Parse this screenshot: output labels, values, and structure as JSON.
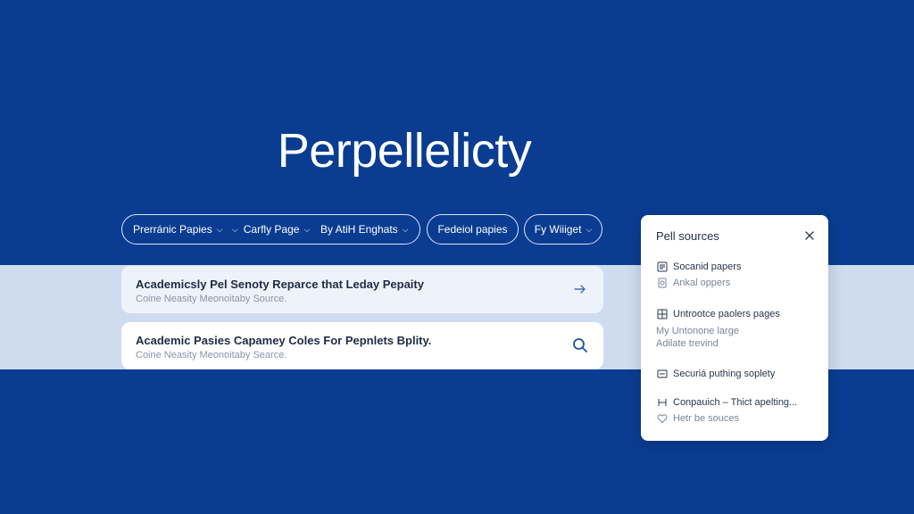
{
  "app": {
    "title": "Perpellelicty"
  },
  "filters": {
    "group": [
      "Prerránic Papies",
      "Carfly Page",
      "By AtiH Enghats"
    ],
    "federal": "Fedeiol papies",
    "widget": "Fy Wiiiget"
  },
  "results": [
    {
      "title": "Academicsly Pel Senoty Reparce that Leday Pepaity",
      "subtitle": "Coine Neasity Meonoitaby Source.",
      "icon": "arrow-right-icon"
    },
    {
      "title": "Academic Pasies Capamey Coles For Pepnlets Bplity.",
      "subtitle": "Coine Neasity Meonoitaby Searce.",
      "icon": "search-icon"
    }
  ],
  "panel": {
    "title": "Pell sources",
    "items": [
      {
        "label": "Socanid papers",
        "icon": "document-icon"
      },
      {
        "label": "Ankal oppers",
        "icon": "file-icon"
      },
      {
        "label": "Untrootce paolers pages",
        "icon": "grid-doc-icon"
      },
      {
        "label": "My Untonone large",
        "icon": ""
      },
      {
        "label": "Adilate trevind",
        "icon": ""
      },
      {
        "label": "Securiá puthing soplety",
        "icon": "list-icon"
      },
      {
        "label": "Conpauich – Thict apelting...",
        "icon": "book-icon"
      },
      {
        "label": "Hetr be souces",
        "icon": "heart-icon"
      }
    ]
  },
  "colors": {
    "background": "#0a3d91",
    "band": "#cfdcf0",
    "accent": "#1f4fa0"
  }
}
